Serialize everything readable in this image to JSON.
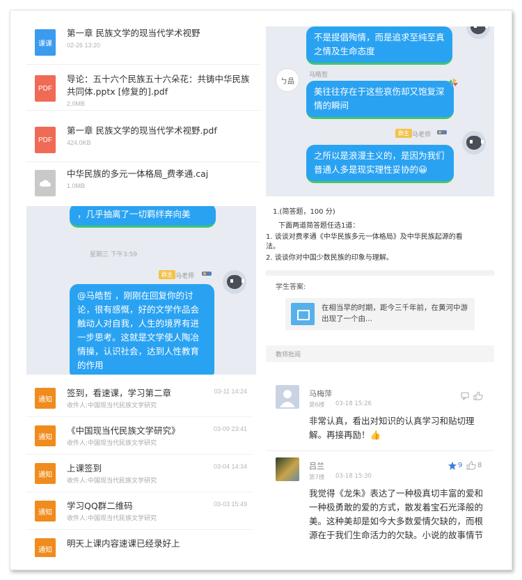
{
  "files": [
    {
      "icon": "课课",
      "title": "第一章 民族文学的现当代学术视野",
      "meta": "02-26 13:20",
      "color": "#3a9bef"
    },
    {
      "icon": "PDF",
      "title": "导论：五十六个民族五十六朵花：共铸中华民族共同体.pptx [修复的].pdf",
      "meta": "2.0MB",
      "color": "#ef6b55"
    },
    {
      "icon": "PDF",
      "title": "第一章 民族文学的现当代学术视野.pdf",
      "meta": "424.0KB",
      "color": "#ef6b55"
    },
    {
      "icon": "",
      "title": "中华民族的多元一体格局_费孝通.caj",
      "meta": "1.0MB",
      "color": "#c9c9c9"
    }
  ],
  "chat_top": {
    "bubble1": "不是提倡殉情，而是追求至纯至真之情及生命态度",
    "user1_name": "马皓哲",
    "bubble2": "美往往存在于这些哀伤却又饱复深情的瞬间",
    "teacher_tag": "群主",
    "teacher_name": "马老师",
    "bubble3": "之所以是浪漫主义的，是因为我们普通人多是现实理性妥协的😀"
  },
  "chat_mid": {
    "bubble1": "，几乎抽离了一切羁绊奔向美",
    "timestamp": "星期三 下午3:59",
    "teacher_tag": "群主",
    "teacher_name": "马老师",
    "bubble2": "@马皓哲 ，刚刚在回复你的讨论，很有感慨，好的文学作品会触动人对自我，人生的境界有进一步思考。这就是文学使人陶冶情操，认识社会，达到人性教育的作用"
  },
  "question": {
    "header": "1.(简答题，100 分)",
    "prompt": "下面两道简答题任选1道：",
    "items": [
      "1. 谈谈对费孝通《中华民族多元一体格局》及中华民族起源的看法。",
      "2. 谈谈你对中国少数民族的印象与理解。"
    ],
    "answer_label": "学生答案:",
    "answer_preview": "在相当早的时期，距今三千年前，在黄河中游出现了一个由...",
    "comment_label": "教师批阅"
  },
  "notices": [
    {
      "icon": "通知",
      "title": "签到，看速课，学习第二章",
      "date": "03-11 14:24",
      "sub": "收件人:中国现当代民族文学研究"
    },
    {
      "icon": "通知",
      "title": "《中国现当代民族文学研究》",
      "date": "03-09 23:41",
      "sub": "收件人:中国现当代民族文学研究"
    },
    {
      "icon": "通知",
      "title": "上课签到",
      "date": "03-04 14:34",
      "sub": "收件人:中国现当代民族文学研究"
    },
    {
      "icon": "通知",
      "title": "学习QQ群二维码",
      "date": "03-03 15:49",
      "sub": "收件人:中国现当代民族文学研究"
    },
    {
      "icon": "通知",
      "title": "明天上课内容速课已经录好上",
      "date": "",
      "sub": ""
    }
  ],
  "comments": [
    {
      "name": "马梅萍",
      "floor": "第6楼",
      "date": "03-18 15:26",
      "body": "非常认真，看出对知识的认真学习和贴切理解。再接再励！👍",
      "likes": ""
    },
    {
      "name": "吕兰",
      "floor": "第7楼",
      "date": "03-18 15:30",
      "body": "我觉得《龙朱》表达了一种极真切丰富的爱和一种极勇敢的爱的方式，散发着宝石光泽般的美。这种美却是如今大多数爱情欠缺的，而根源在于我们生命活力的欠缺。小说的故事情节",
      "likes": "8",
      "stars": "9"
    }
  ]
}
